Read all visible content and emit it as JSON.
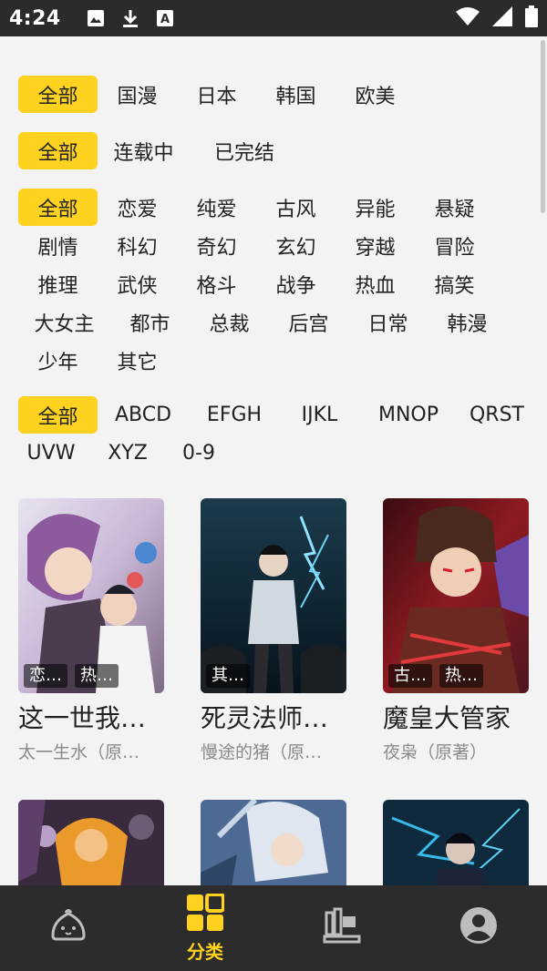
{
  "status_bar": {
    "time": "4:24",
    "icons": [
      "image-icon",
      "download-icon",
      "a-box-icon",
      "wifi-icon",
      "signal-icon",
      "battery-icon"
    ]
  },
  "filters": {
    "region": [
      "全部",
      "国漫",
      "日本",
      "韩国",
      "欧美"
    ],
    "status": [
      "全部",
      "连载中",
      "已完结"
    ],
    "genre": [
      "全部",
      "恋爱",
      "纯爱",
      "古风",
      "异能",
      "悬疑",
      "剧情",
      "科幻",
      "奇幻",
      "玄幻",
      "穿越",
      "冒险",
      "推理",
      "武侠",
      "格斗",
      "战争",
      "热血",
      "搞笑",
      "大女主",
      "都市",
      "总裁",
      "后宫",
      "日常",
      "韩漫",
      "少年",
      "其它"
    ],
    "letter": [
      "全部",
      "ABCD",
      "EFGH",
      "IJKL",
      "MNOP",
      "QRST",
      "UVW",
      "XYZ",
      "0-9"
    ],
    "selected": "全部"
  },
  "comics": [
    {
      "title": "这一世我…",
      "author": "太一生水（原…",
      "tags": [
        "恋…",
        "热…"
      ]
    },
    {
      "title": "死灵法师…",
      "author": "慢途的猪（原…",
      "tags": [
        "其…"
      ]
    },
    {
      "title": "魔皇大管家",
      "author": "夜枭（原著）",
      "tags": [
        "古…",
        "热…"
      ]
    },
    {
      "title": "",
      "author": "",
      "tags": []
    },
    {
      "title": "",
      "author": "",
      "tags": []
    },
    {
      "title": "",
      "author": "",
      "tags": []
    }
  ],
  "bottom_nav": {
    "items": [
      {
        "icon": "bun-icon",
        "label": ""
      },
      {
        "icon": "grid-icon",
        "label": "分类"
      },
      {
        "icon": "bookshelf-icon",
        "label": ""
      },
      {
        "icon": "profile-icon",
        "label": ""
      }
    ],
    "active_label": "分类"
  },
  "colors": {
    "accent": "#ffd21f",
    "bar": "#2c2c2c",
    "background": "#f3f3f3"
  }
}
